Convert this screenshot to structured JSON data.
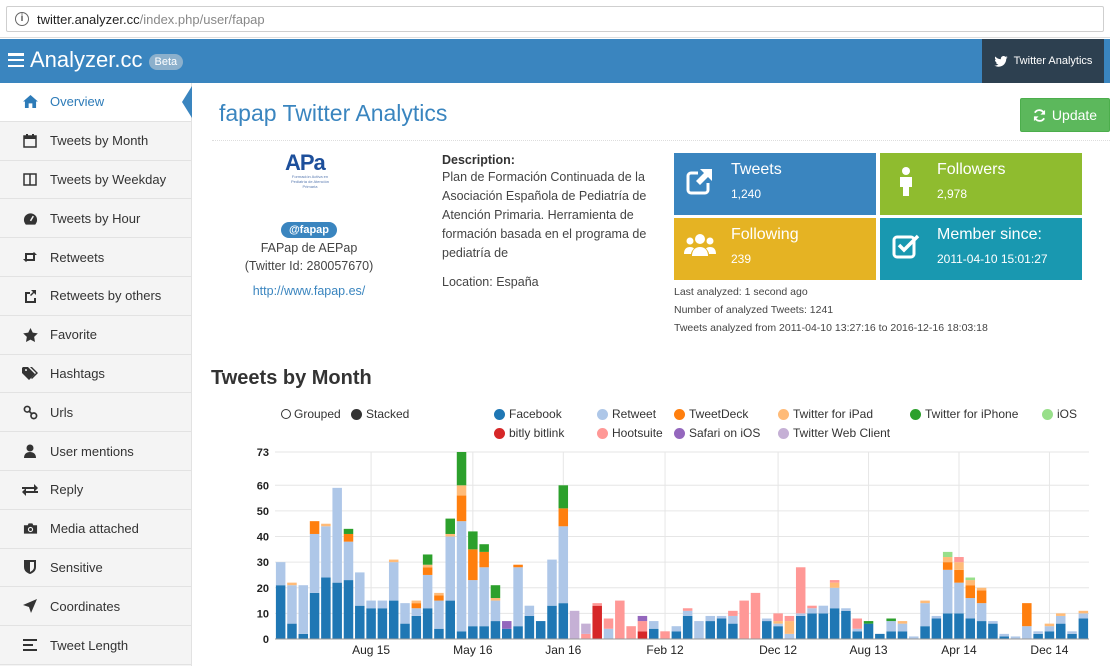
{
  "browser": {
    "url_host": "twitter.analyzer.cc",
    "url_path": "/index.php/user/fapap"
  },
  "navbar": {
    "brand": "Analyzer.cc",
    "badge": "Beta",
    "twitter_button": "Twitter Analytics"
  },
  "sidebar": {
    "items": [
      {
        "label": "Overview",
        "icon": "home-icon"
      },
      {
        "label": "Tweets by Month",
        "icon": "calendar-icon"
      },
      {
        "label": "Tweets by Weekday",
        "icon": "columns-icon"
      },
      {
        "label": "Tweets by Hour",
        "icon": "dashboard-icon"
      },
      {
        "label": "Retweets",
        "icon": "retweet-icon"
      },
      {
        "label": "Retweets by others",
        "icon": "share-icon"
      },
      {
        "label": "Favorite",
        "icon": "star-icon"
      },
      {
        "label": "Hashtags",
        "icon": "tags-icon"
      },
      {
        "label": "Urls",
        "icon": "link-icon"
      },
      {
        "label": "User mentions",
        "icon": "user-icon"
      },
      {
        "label": "Reply",
        "icon": "exchange-icon"
      },
      {
        "label": "Media attached",
        "icon": "camera-icon"
      },
      {
        "label": "Sensitive",
        "icon": "shield-icon"
      },
      {
        "label": "Coordinates",
        "icon": "location-arrow-icon"
      },
      {
        "label": "Tweet Length",
        "icon": "text-align-icon"
      }
    ]
  },
  "main": {
    "title": "fapap Twitter Analytics",
    "update_button": "Update",
    "profile": {
      "logo_main": "APa",
      "logo_sub": "Formación Activa en Pediatría de Atención Primaria",
      "handle": "@fapap",
      "name": "FAPap de AEPap",
      "twitter_id": "(Twitter Id: 280057670)",
      "website": "http://www.fapap.es/"
    },
    "description": {
      "label": "Description:",
      "text": "Plan de Formación Continuada de la Asociación Española de Pediatría de Atención Primaria. Herramienta de formación basada en el programa de pediatría de",
      "location": "Location: España"
    },
    "tiles": {
      "tweets": {
        "label": "Tweets",
        "value": "1,240"
      },
      "followers": {
        "label": "Followers",
        "value": "2,978"
      },
      "following": {
        "label": "Following",
        "value": "239"
      },
      "member_since": {
        "label": "Member since:",
        "value": "2011-04-10 15:01:27"
      }
    },
    "meta": {
      "last_analyzed": "Last analyzed: 1 second ago",
      "analyzed_count": "Number of analyzed Tweets: 1241",
      "range": "Tweets analyzed from 2011-04-10 13:27:16 to 2016-12-16 18:03:18"
    },
    "chart_section_title": "Tweets by Month"
  },
  "colors": {
    "accent": "#3a85bf",
    "navbar": "#3a85bf",
    "twitter_button": "#2d4050",
    "tile_tweets": "#3a85bf",
    "tile_followers": "#8fbc2f",
    "tile_following": "#e5b323",
    "tile_member": "#1998b0",
    "update_button": "#5cb85c"
  },
  "chart_data": {
    "type": "bar",
    "stacked": true,
    "modes": [
      "Grouped",
      "Stacked"
    ],
    "selected_mode": "Stacked",
    "legend": [
      {
        "name": "Facebook",
        "color": "#1f77b4"
      },
      {
        "name": "Retweet",
        "color": "#aec7e8"
      },
      {
        "name": "TweetDeck",
        "color": "#ff7f0e"
      },
      {
        "name": "Twitter for iPad",
        "color": "#ffbb78"
      },
      {
        "name": "Twitter for iPhone",
        "color": "#2ca02c"
      },
      {
        "name": "iOS",
        "color": "#98df8a"
      },
      {
        "name": "bitly bitlink",
        "color": "#d62728"
      },
      {
        "name": "Hootsuite",
        "color": "#ff9896"
      },
      {
        "name": "Safari on iOS",
        "color": "#9467bd"
      },
      {
        "name": "Twitter Web Client",
        "color": "#c5b0d5"
      }
    ],
    "ylim": [
      0,
      73
    ],
    "yticks": [
      0,
      10,
      20,
      30,
      40,
      50,
      60,
      73
    ],
    "xticks": [
      {
        "label": "Aug 15",
        "index": 8
      },
      {
        "label": "May 16",
        "index": 17
      },
      {
        "label": "Jan 16",
        "index": 25
      },
      {
        "label": "Feb 12",
        "index": 34
      },
      {
        "label": "Dec 12",
        "index": 44
      },
      {
        "label": "Aug 13",
        "index": 52
      },
      {
        "label": "Apr 14",
        "index": 60
      },
      {
        "label": "Dec 14",
        "index": 68
      }
    ],
    "stacks": [
      [
        21,
        9,
        0,
        0,
        0,
        0,
        0,
        0,
        0,
        0
      ],
      [
        6,
        15,
        0,
        1,
        0,
        0,
        0,
        0,
        0,
        0
      ],
      [
        2,
        19,
        0,
        0,
        0,
        0,
        0,
        0,
        0,
        0
      ],
      [
        18,
        23,
        5,
        0,
        0,
        0,
        0,
        0,
        0,
        0
      ],
      [
        24,
        20,
        0,
        1,
        0,
        0,
        0,
        0,
        0,
        0
      ],
      [
        22,
        37,
        0,
        0,
        0,
        0,
        0,
        0,
        0,
        0
      ],
      [
        23,
        15,
        3,
        0,
        2,
        0,
        0,
        0,
        0,
        0
      ],
      [
        13,
        13,
        0,
        0,
        0,
        0,
        0,
        0,
        0,
        0
      ],
      [
        12,
        3,
        0,
        0,
        0,
        0,
        0,
        0,
        0,
        0
      ],
      [
        12,
        3,
        0,
        0,
        0,
        0,
        0,
        0,
        0,
        0
      ],
      [
        15,
        15,
        0,
        1,
        0,
        0,
        0,
        0,
        0,
        0
      ],
      [
        6,
        8,
        0,
        0,
        0,
        0,
        0,
        0,
        0,
        0
      ],
      [
        9,
        3,
        2,
        1,
        0,
        0,
        0,
        0,
        0,
        0
      ],
      [
        12,
        13,
        3,
        1,
        4,
        0,
        0,
        0,
        0,
        0
      ],
      [
        4,
        11,
        2,
        1,
        0,
        0,
        0,
        0,
        0,
        0
      ],
      [
        15,
        25,
        0,
        1,
        6,
        0,
        0,
        0,
        0,
        0
      ],
      [
        3,
        43,
        10,
        4,
        13,
        0,
        0,
        0,
        0,
        0
      ],
      [
        5,
        18,
        12,
        0,
        7,
        0,
        0,
        0,
        0,
        0
      ],
      [
        5,
        23,
        6,
        0,
        3,
        0,
        0,
        0,
        0,
        0
      ],
      [
        7,
        8,
        0,
        1,
        5,
        0,
        0,
        0,
        0,
        0
      ],
      [
        4,
        0,
        0,
        0,
        0,
        0,
        0,
        0,
        3,
        0
      ],
      [
        5,
        23,
        1,
        0,
        0,
        0,
        0,
        0,
        0,
        0
      ],
      [
        9,
        4,
        0,
        0,
        0,
        0,
        0,
        0,
        0,
        0
      ],
      [
        7,
        0,
        0,
        0,
        0,
        0,
        0,
        0,
        0,
        0
      ],
      [
        13,
        18,
        0,
        0,
        0,
        0,
        0,
        0,
        0,
        0
      ],
      [
        14,
        30,
        7,
        0,
        9,
        0,
        0,
        0,
        0,
        0
      ],
      [
        0,
        0,
        0,
        0,
        0,
        0,
        0,
        0,
        0,
        11
      ],
      [
        0,
        0,
        0,
        0,
        0,
        0,
        0,
        2,
        0,
        4
      ],
      [
        0,
        0,
        0,
        0,
        0,
        0,
        13,
        1,
        0,
        0
      ],
      [
        0,
        4,
        0,
        0,
        0,
        0,
        0,
        4,
        0,
        0
      ],
      [
        0,
        0,
        0,
        0,
        0,
        0,
        0,
        15,
        0,
        0
      ],
      [
        0,
        0,
        0,
        0,
        0,
        0,
        0,
        5,
        0,
        0
      ],
      [
        0,
        0,
        0,
        0,
        0,
        0,
        3,
        4,
        2,
        0
      ],
      [
        4,
        3,
        0,
        0,
        0,
        0,
        0,
        0,
        0,
        0
      ],
      [
        0,
        0,
        0,
        0,
        0,
        0,
        0,
        3,
        0,
        0
      ],
      [
        3,
        2,
        0,
        0,
        0,
        0,
        0,
        0,
        0,
        0
      ],
      [
        9,
        2,
        0,
        0,
        0,
        0,
        0,
        1,
        0,
        0
      ],
      [
        0,
        7,
        0,
        0,
        0,
        0,
        0,
        0,
        0,
        0
      ],
      [
        7,
        2,
        0,
        0,
        0,
        0,
        0,
        0,
        0,
        0
      ],
      [
        8,
        1,
        0,
        0,
        0,
        0,
        0,
        0,
        0,
        0
      ],
      [
        6,
        3,
        0,
        0,
        0,
        0,
        0,
        2,
        0,
        0
      ],
      [
        0,
        0,
        0,
        0,
        0,
        0,
        0,
        15,
        0,
        0
      ],
      [
        0,
        0,
        0,
        0,
        0,
        0,
        0,
        18,
        0,
        0
      ],
      [
        7,
        1,
        0,
        0,
        0,
        0,
        0,
        0,
        0,
        0
      ],
      [
        5,
        1,
        0,
        1,
        0,
        0,
        0,
        3,
        0,
        0
      ],
      [
        0,
        2,
        0,
        5,
        0,
        0,
        0,
        2,
        0,
        0
      ],
      [
        9,
        1,
        0,
        0,
        0,
        0,
        0,
        18,
        0,
        0
      ],
      [
        10,
        2,
        0,
        0,
        0,
        0,
        0,
        1,
        0,
        0
      ],
      [
        10,
        3,
        0,
        0,
        0,
        0,
        0,
        0,
        0,
        0
      ],
      [
        12,
        8,
        0,
        2,
        0,
        0,
        0,
        1,
        0,
        0
      ],
      [
        11,
        1,
        0,
        0,
        0,
        0,
        0,
        0,
        0,
        0
      ],
      [
        3,
        1,
        0,
        0,
        0,
        0,
        0,
        4,
        0,
        0
      ],
      [
        6,
        0,
        0,
        0,
        1,
        0,
        0,
        0,
        0,
        0
      ],
      [
        2,
        0,
        0,
        0,
        0,
        0,
        0,
        0,
        0,
        0
      ],
      [
        3,
        4,
        0,
        0,
        1,
        0,
        0,
        0,
        0,
        0
      ],
      [
        3,
        3,
        0,
        1,
        0,
        0,
        0,
        0,
        0,
        0
      ],
      [
        0,
        1,
        0,
        0,
        0,
        0,
        0,
        0,
        0,
        0
      ],
      [
        5,
        9,
        0,
        1,
        0,
        0,
        0,
        0,
        0,
        0
      ],
      [
        8,
        1,
        0,
        0,
        0,
        0,
        0,
        0,
        0,
        0
      ],
      [
        10,
        17,
        3,
        2,
        0,
        2,
        0,
        0,
        0,
        0
      ],
      [
        10,
        12,
        5,
        3,
        0,
        0,
        0,
        2,
        0,
        0
      ],
      [
        8,
        8,
        5,
        2,
        0,
        1,
        0,
        0,
        0,
        0
      ],
      [
        7,
        7,
        5,
        1,
        0,
        0,
        0,
        0,
        0,
        0
      ],
      [
        6,
        1,
        0,
        0,
        0,
        0,
        0,
        0,
        0,
        0
      ],
      [
        1,
        1,
        0,
        0,
        0,
        0,
        0,
        0,
        0,
        0
      ],
      [
        0,
        1,
        0,
        0,
        0,
        0,
        0,
        0,
        0,
        0
      ],
      [
        0,
        5,
        9,
        0,
        0,
        0,
        0,
        0,
        0,
        0
      ],
      [
        2,
        1,
        0,
        0,
        0,
        0,
        0,
        0,
        0,
        0
      ],
      [
        3,
        2,
        0,
        1,
        0,
        0,
        0,
        0,
        0,
        0
      ],
      [
        6,
        3,
        0,
        1,
        0,
        0,
        0,
        0,
        0,
        0
      ],
      [
        2,
        1,
        0,
        0,
        0,
        0,
        0,
        0,
        0,
        0
      ],
      [
        8,
        2,
        0,
        1,
        0,
        0,
        0,
        0,
        0,
        0
      ]
    ]
  }
}
